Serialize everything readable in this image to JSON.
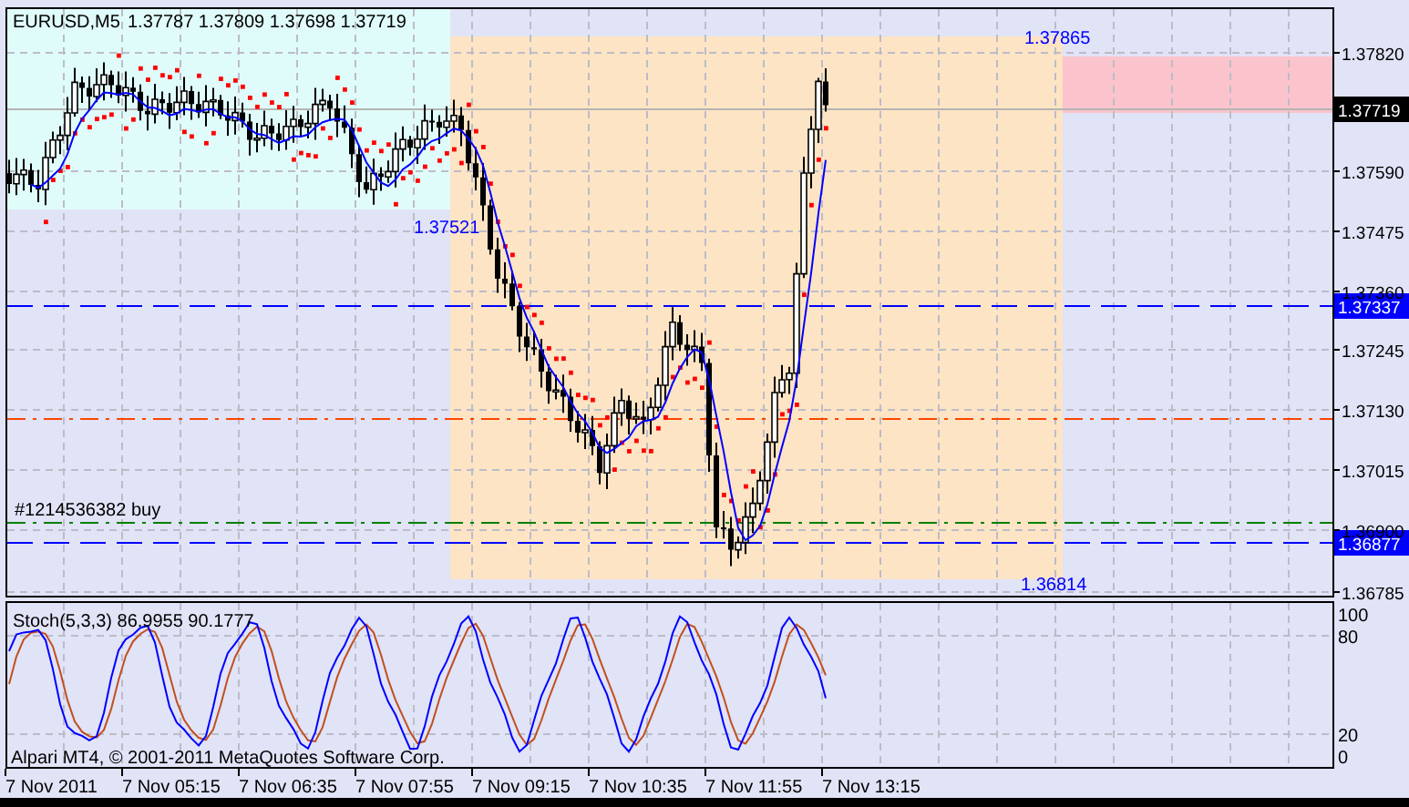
{
  "header": {
    "symbol": "EURUSD,M5",
    "quote": "1.37787 1.37809 1.37698 1.37719"
  },
  "price_axis": {
    "ticks": [
      "1.37820",
      "1.37590",
      "1.37475",
      "1.37360",
      "1.37245",
      "1.37130",
      "1.37015",
      "1.36900",
      "1.36785"
    ],
    "current_price": "1.37719"
  },
  "levels": [
    {
      "kind": "dashed",
      "color": "#0000ff",
      "tag": "1.37337"
    },
    {
      "kind": "dash-dot",
      "color": "#ff4500"
    },
    {
      "kind": "dash-dot",
      "color": "#008000",
      "label": "#1214536382 buy"
    },
    {
      "kind": "dashed",
      "color": "#0000ff",
      "tag": "1.36877"
    }
  ],
  "price_labels": [
    "1.37865",
    "1.37521",
    "1.36814"
  ],
  "stochastic": {
    "label": "Stoch(5,3,3) 86.9955 90.1777",
    "ticks": [
      "100",
      "80",
      "20",
      "0"
    ]
  },
  "copyright": "Alpari MT4, © 2001-2011 MetaQuotes Software Corp.",
  "time_axis": [
    "7 Nov 2011",
    "7 Nov 05:15",
    "7 Nov 06:35",
    "7 Nov 07:55",
    "7 Nov 09:15",
    "7 Nov 10:35",
    "7 Nov 11:55",
    "7 Nov 13:15"
  ]
}
